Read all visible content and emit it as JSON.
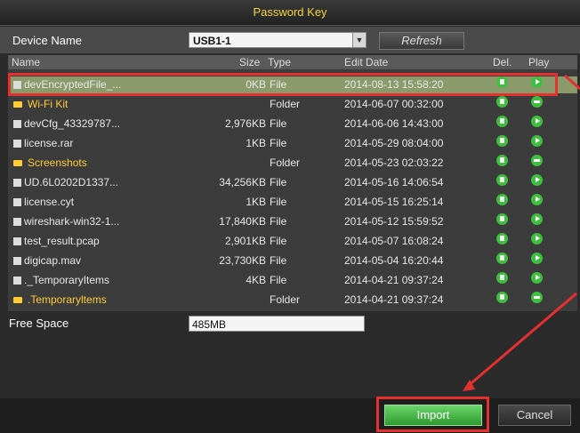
{
  "window": {
    "title": "Password Key"
  },
  "device": {
    "label": "Device Name",
    "value": "USB1-1",
    "refresh_label": "Refresh"
  },
  "table": {
    "headers": {
      "name": "Name",
      "size": "Size",
      "type": "Type",
      "date": "Edit Date",
      "del": "Del.",
      "play": "Play"
    },
    "rows": [
      {
        "name": "devEncryptedFile_...",
        "size": "0KB",
        "type": "File",
        "date": "2014-08-13 15:58:20",
        "kind": "file",
        "action": "play",
        "selected": true
      },
      {
        "name": "Wi-Fi Kit",
        "size": "",
        "type": "Folder",
        "date": "2014-06-07 00:32:00",
        "kind": "folder",
        "action": "stop"
      },
      {
        "name": "devCfg_43329787...",
        "size": "2,976KB",
        "type": "File",
        "date": "2014-06-06 14:43:00",
        "kind": "file",
        "action": "play"
      },
      {
        "name": "license.rar",
        "size": "1KB",
        "type": "File",
        "date": "2014-05-29 08:04:00",
        "kind": "file",
        "action": "play"
      },
      {
        "name": "Screenshots",
        "size": "",
        "type": "Folder",
        "date": "2014-05-23 02:03:22",
        "kind": "folder",
        "action": "stop"
      },
      {
        "name": "UD.6L0202D1337...",
        "size": "34,256KB",
        "type": "File",
        "date": "2014-05-16 14:06:54",
        "kind": "file",
        "action": "play"
      },
      {
        "name": "license.cyt",
        "size": "1KB",
        "type": "File",
        "date": "2014-05-15 16:25:14",
        "kind": "file",
        "action": "play"
      },
      {
        "name": "wireshark-win32-1...",
        "size": "17,840KB",
        "type": "File",
        "date": "2014-05-12 15:59:52",
        "kind": "file",
        "action": "play"
      },
      {
        "name": "test_result.pcap",
        "size": "2,901KB",
        "type": "File",
        "date": "2014-05-07 16:08:24",
        "kind": "file",
        "action": "play"
      },
      {
        "name": "digicap.mav",
        "size": "23,730KB",
        "type": "File",
        "date": "2014-05-04 16:20:44",
        "kind": "file",
        "action": "play"
      },
      {
        "name": "._TemporaryItems",
        "size": "4KB",
        "type": "File",
        "date": "2014-04-21 09:37:24",
        "kind": "file",
        "action": "play"
      },
      {
        "name": ".Temporaryltems",
        "size": "",
        "type": "Folder",
        "date": "2014-04-21 09:37:24",
        "kind": "folder",
        "action": "stop"
      }
    ]
  },
  "free_space": {
    "label": "Free Space",
    "value": "485MB"
  },
  "buttons": {
    "import": "Import",
    "cancel": "Cancel"
  }
}
